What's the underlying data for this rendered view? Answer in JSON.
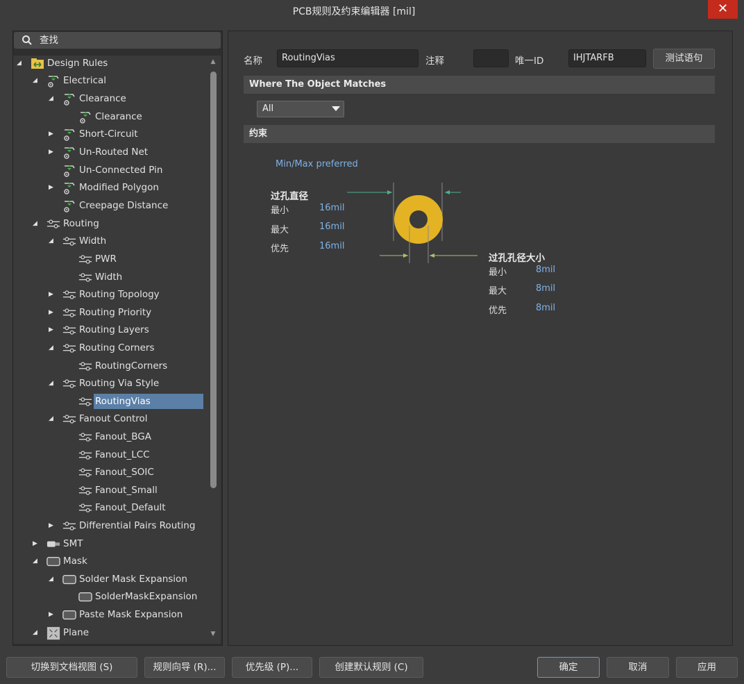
{
  "window": {
    "title": "PCB规则及约束编辑器 [mil]",
    "close_label": "✕"
  },
  "search": {
    "label": "查找"
  },
  "tree": [
    {
      "label": "Design Rules",
      "icon": "design-rules-folder-icon",
      "toggle": "expanded"
    },
    {
      "label": "Electrical",
      "icon": "electrical-rule-icon",
      "toggle": "expanded"
    },
    {
      "label": "Clearance",
      "icon": "electrical-rule-icon",
      "toggle": "expanded"
    },
    {
      "label": "Clearance",
      "icon": "electrical-rule-icon",
      "toggle": "none"
    },
    {
      "label": "Short-Circuit",
      "icon": "electrical-rule-icon",
      "toggle": "collapsed"
    },
    {
      "label": "Un-Routed Net",
      "icon": "electrical-rule-icon",
      "toggle": "collapsed"
    },
    {
      "label": "Un-Connected Pin",
      "icon": "electrical-rule-icon",
      "toggle": "none"
    },
    {
      "label": "Modified Polygon",
      "icon": "electrical-rule-icon",
      "toggle": "collapsed"
    },
    {
      "label": "Creepage Distance",
      "icon": "electrical-rule-icon",
      "toggle": "none"
    },
    {
      "label": "Routing",
      "icon": "routing-rule-icon",
      "toggle": "expanded"
    },
    {
      "label": "Width",
      "icon": "routing-rule-icon",
      "toggle": "expanded"
    },
    {
      "label": "PWR",
      "icon": "routing-rule-icon",
      "toggle": "none"
    },
    {
      "label": "Width",
      "icon": "routing-rule-icon",
      "toggle": "none"
    },
    {
      "label": "Routing Topology",
      "icon": "routing-rule-icon",
      "toggle": "collapsed"
    },
    {
      "label": "Routing Priority",
      "icon": "routing-rule-icon",
      "toggle": "collapsed"
    },
    {
      "label": "Routing Layers",
      "icon": "routing-rule-icon",
      "toggle": "collapsed"
    },
    {
      "label": "Routing Corners",
      "icon": "routing-rule-icon",
      "toggle": "expanded"
    },
    {
      "label": "RoutingCorners",
      "icon": "routing-rule-icon",
      "toggle": "none"
    },
    {
      "label": "Routing Via Style",
      "icon": "routing-rule-icon",
      "toggle": "expanded"
    },
    {
      "label": "RoutingVias",
      "icon": "routing-rule-icon",
      "toggle": "none",
      "selected": true
    },
    {
      "label": "Fanout Control",
      "icon": "routing-rule-icon",
      "toggle": "expanded"
    },
    {
      "label": "Fanout_BGA",
      "icon": "routing-rule-icon",
      "toggle": "none"
    },
    {
      "label": "Fanout_LCC",
      "icon": "routing-rule-icon",
      "toggle": "none"
    },
    {
      "label": "Fanout_SOIC",
      "icon": "routing-rule-icon",
      "toggle": "none"
    },
    {
      "label": "Fanout_Small",
      "icon": "routing-rule-icon",
      "toggle": "none"
    },
    {
      "label": "Fanout_Default",
      "icon": "routing-rule-icon",
      "toggle": "none"
    },
    {
      "label": "Differential Pairs Routing",
      "icon": "routing-rule-icon",
      "toggle": "collapsed"
    },
    {
      "label": "SMT",
      "icon": "smt-rule-icon",
      "toggle": "collapsed"
    },
    {
      "label": "Mask",
      "icon": "mask-rule-icon",
      "toggle": "expanded"
    },
    {
      "label": "Solder Mask Expansion",
      "icon": "mask-rule-icon",
      "toggle": "expanded"
    },
    {
      "label": "SolderMaskExpansion",
      "icon": "mask-rule-icon",
      "toggle": "none"
    },
    {
      "label": "Paste Mask Expansion",
      "icon": "mask-rule-icon",
      "toggle": "collapsed"
    },
    {
      "label": "Plane",
      "icon": "plane-rule-icon",
      "toggle": "expanded"
    }
  ],
  "rule": {
    "name_label": "名称",
    "name_value": "RoutingVias",
    "comment_label": "注释",
    "comment_value": "",
    "uid_label": "唯一ID",
    "uid_value": "IHJTARFB",
    "test_button": "测试语句"
  },
  "where": {
    "header": "Where The Object Matches",
    "selected": "All"
  },
  "constraints": {
    "header": "约束",
    "mode": "Min/Max preferred",
    "diameter": {
      "title": "过孔直径",
      "rows": [
        {
          "label": "最小",
          "value": "16mil"
        },
        {
          "label": "最大",
          "value": "16mil"
        },
        {
          "label": "优先",
          "value": "16mil"
        }
      ]
    },
    "hole": {
      "title": "过孔孔径大小",
      "rows": [
        {
          "label": "最小",
          "value": "8mil"
        },
        {
          "label": "最大",
          "value": "8mil"
        },
        {
          "label": "优先",
          "value": "8mil"
        }
      ]
    }
  },
  "buttons": {
    "doc_view": "切换到文档视图 (S)",
    "wizard": "规则向导 (R)...",
    "priority": "优先级 (P)...",
    "default_rules": "创建默认规则 (C)",
    "ok": "确定",
    "cancel": "取消",
    "apply": "应用"
  },
  "colors": {
    "via": "#e3b324",
    "selection": "#5b7fa6",
    "value_blue": "#7fb2e5",
    "close": "#c42b1c"
  }
}
